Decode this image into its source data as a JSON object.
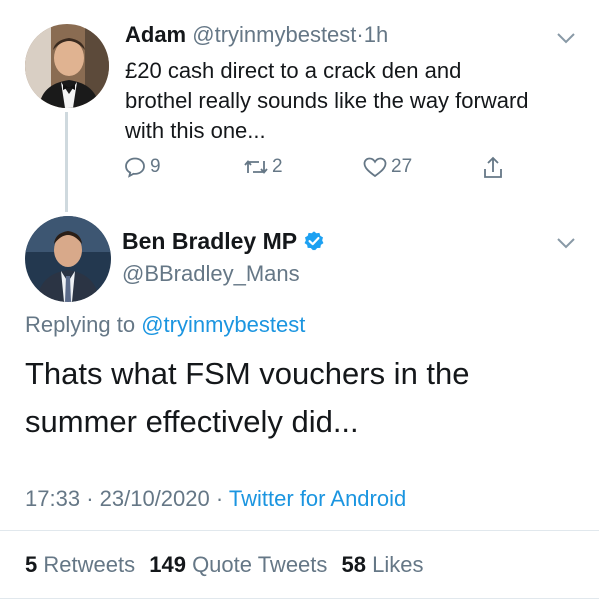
{
  "reply_tweet": {
    "author_name": "Adam",
    "handle": "@tryinmybestest",
    "separator": "·",
    "time": "1h",
    "text_lines": [
      "£20 cash direct to a crack den and",
      "brothel really sounds like the way forward",
      "with this one..."
    ],
    "actions": {
      "replies": "9",
      "retweets": "2",
      "likes": "27"
    }
  },
  "main_tweet": {
    "author_name": "Ben Bradley MP",
    "handle": "@BBradley_Mans",
    "verified": true,
    "replying_prefix": "Replying to",
    "replying_to": "@tryinmybestest",
    "text_lines": [
      "Thats what FSM vouchers in the",
      "summer effectively did..."
    ],
    "time": "17:33",
    "separator": "·",
    "date": "23/10/2020",
    "source": "Twitter for Android"
  },
  "stats": {
    "retweets_count": "5",
    "retweets_label": "Retweets",
    "quote_count": "149",
    "quote_label": "Quote Tweets",
    "likes_count": "58",
    "likes_label": "Likes"
  },
  "colors": {
    "accent": "#1b95e0",
    "muted": "#657786",
    "verified": "#1da1f2"
  }
}
